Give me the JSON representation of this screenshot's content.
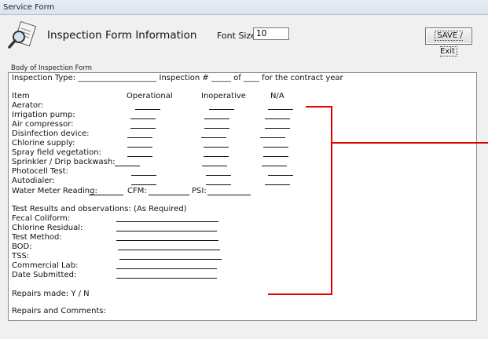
{
  "window": {
    "title": "Service Form"
  },
  "header": {
    "title": "Inspection Form Information",
    "font_size_label": "Font Size:",
    "font_size_value": "10",
    "save_label": "SAVE / Exit"
  },
  "body_label": "Body of Inspection Form",
  "form": {
    "inspection_type_line": "Inspection Type: ____________________   Inspection # _____ of ____ for the contract year",
    "columns": {
      "item": "Item",
      "operational": "Operational",
      "inoperative": "Inoperative",
      "na": "N/A"
    },
    "items": [
      "Aerator:",
      "Irrigation pump:",
      "Air compressor:",
      "Disinfection device:",
      "Chlorine supply:",
      "Spray field vegetation:",
      "Sprinkler / Drip backwash:",
      "Photocell Test:",
      "Autodialer:"
    ],
    "water_meter_label": "Water Meter Reading:",
    "cfm_label": "CFM:",
    "psi_label": "PSI:",
    "test_results_heading": "Test Results and observations:  (As Required)",
    "tests": [
      "Fecal Coliform:",
      "Chlorine Residual:",
      "Test Method:",
      "BOD:",
      "TSS:",
      "Commercial Lab:",
      "Date Submitted:"
    ],
    "repairs_made": "Repairs made:  Y / N",
    "repairs_comments": "Repairs and Comments:"
  }
}
